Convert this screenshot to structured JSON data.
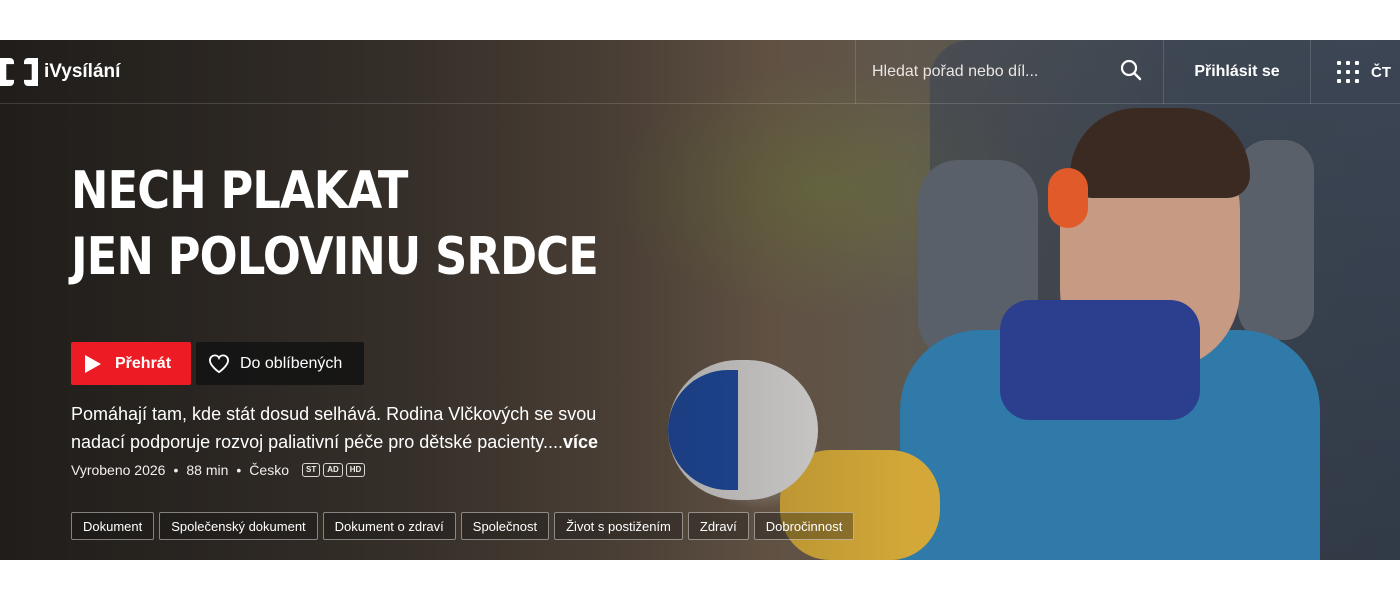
{
  "header": {
    "logo_text": "iVysílání",
    "search_placeholder": "Hledat pořad nebo díl...",
    "login_label": "Přihlásit se",
    "ct_label": "ČT"
  },
  "hero": {
    "title_line1": "NECH PLAKAT",
    "title_line2": "JEN POLOVINU SRDCE",
    "play_label": "Přehrát",
    "favorite_label": "Do oblíbených",
    "description": "Pomáhají tam, kde stát dosud selhává. Rodina Vlčkových se svou nadací podporuje rozvoj paliativní péče pro dětské pacienty....",
    "more_label": "více",
    "meta": {
      "produced": "Vyrobeno 2026",
      "duration": "88 min",
      "country": "Česko",
      "badges": [
        "ST",
        "AD",
        "HD"
      ]
    },
    "tags": [
      "Dokument",
      "Společenský dokument",
      "Dokument o zdraví",
      "Společnost",
      "Život s postižením",
      "Zdraví",
      "Dobročinnost"
    ]
  },
  "colors": {
    "play_button": "#ed1c24",
    "favorite_button": "#141414"
  },
  "icons": [
    "logo-icon",
    "search-icon",
    "apps-grid-icon",
    "play-icon",
    "heart-icon"
  ]
}
